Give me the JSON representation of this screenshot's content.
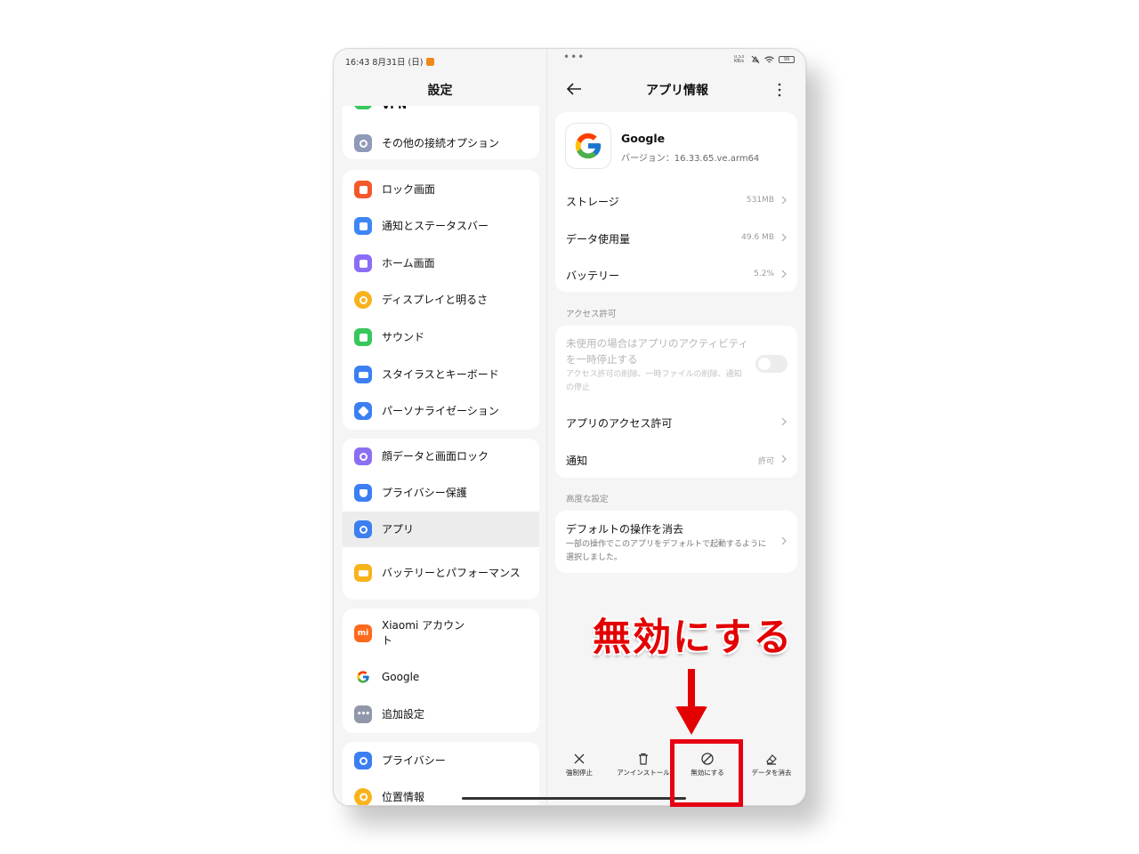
{
  "status_bar": {
    "time": "16:43  8月31日 (日)",
    "dots": "•••",
    "net_speed": "0.53 KB/s",
    "battery": "99"
  },
  "left": {
    "title": "設定",
    "partial_item": "VPN",
    "items": [
      {
        "label": "その他の接続オプション",
        "icon": "link-icon",
        "color": "#8e9ab8"
      },
      {
        "label": "ロック画面",
        "icon": "lock-icon",
        "color": "#f4592b"
      },
      {
        "label": "通知とステータスバー",
        "icon": "notification-icon",
        "color": "#3d86f5"
      },
      {
        "label": "ホーム画面",
        "icon": "home-icon",
        "color": "#8b6df5"
      },
      {
        "label": "ディスプレイと明るさ",
        "icon": "sun-icon",
        "color": "#f8b31c"
      },
      {
        "label": "サウンド",
        "icon": "speaker-icon",
        "color": "#37c85c"
      },
      {
        "label": "スタイラスとキーボード",
        "icon": "keyboard-icon",
        "color": "#3b7ff2"
      },
      {
        "label": "パーソナライゼーション",
        "icon": "brush-icon",
        "color": "#3b7ff2"
      },
      {
        "label": "顔データと画面ロック",
        "icon": "fingerprint-icon",
        "color": "#8a6ff3"
      },
      {
        "label": "プライバシー保護",
        "icon": "shield-icon",
        "color": "#3b7ff2"
      },
      {
        "label": "アプリ",
        "icon": "gear-icon",
        "color": "#3b7ff2"
      },
      {
        "label": "バッテリーとパフォーマンス",
        "icon": "battery-icon",
        "color": "#f8b31c"
      },
      {
        "label": "Xiaomi アカウント",
        "icon": "mi-icon",
        "color": "#fd6a1c"
      },
      {
        "label": "Google",
        "icon": "google-icon",
        "color": "#ffffff"
      },
      {
        "label": "追加設定",
        "icon": "more-dots-icon",
        "color": "#9097ab"
      },
      {
        "label": "プライバシー",
        "icon": "eye-icon",
        "color": "#3b7ff2"
      },
      {
        "label": "位置情報",
        "icon": "location-icon",
        "color": "#f8b31c"
      }
    ]
  },
  "right": {
    "title": "アプリ情報",
    "app": {
      "name": "Google",
      "version": "バージョン：16.33.65.ve.arm64"
    },
    "info_rows": [
      {
        "label": "ストレージ",
        "value": "531MB"
      },
      {
        "label": "データ使用量",
        "value": "49.6 MB"
      },
      {
        "label": "バッテリー",
        "value": "5.2%"
      }
    ],
    "section_access": "アクセス許可",
    "pause_title": "未使用の場合はアプリのアクティビティを一時停止する",
    "pause_sub": "アクセス許可の削除、一時ファイルの削除、通知の停止",
    "pause_toggle_on": false,
    "access_rows": [
      {
        "label": "アプリのアクセス許可",
        "value": ""
      },
      {
        "label": "通知",
        "value": "許可"
      }
    ],
    "section_advanced": "高度な設定",
    "defaults_title": "デフォルトの操作を消去",
    "defaults_sub": "一部の操作でこのアプリをデフォルトで起動するように選択しました。",
    "actions": [
      {
        "label": "強制停止",
        "icon": "close-icon"
      },
      {
        "label": "アンインストール",
        "icon": "trash-icon"
      },
      {
        "label": "無効にする",
        "icon": "disable-icon"
      },
      {
        "label": "データを消去",
        "icon": "eraser-icon"
      }
    ]
  },
  "annotation": {
    "text": "無効にする",
    "color": "#e30000"
  }
}
